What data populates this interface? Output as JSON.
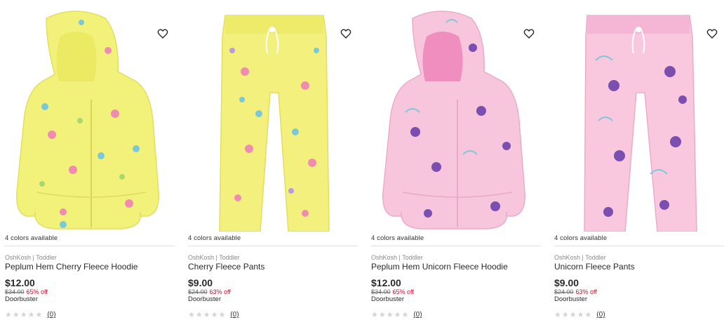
{
  "products": [
    {
      "colors_available": "4 colors available",
      "brand": "OshKosh | Toddler",
      "title": "Peplum Hem Cherry Fleece Hoodie",
      "price": "$12.00",
      "original_price": "$34.00",
      "discount": "65% off",
      "badge": "Doorbuster",
      "stars": "★★★★★",
      "review_count": "(0)",
      "garment": "hoodie",
      "fabric_color": "#f2f27a",
      "icon": "heart-icon"
    },
    {
      "colors_available": "4 colors available",
      "brand": "OshKosh | Toddler",
      "title": "Cherry Fleece Pants",
      "price": "$9.00",
      "original_price": "$24.00",
      "discount": "63% off",
      "badge": "Doorbuster",
      "stars": "★★★★★",
      "review_count": "(0)",
      "garment": "pants",
      "fabric_color": "#f4f07e",
      "icon": "heart-icon"
    },
    {
      "colors_available": "4 colors available",
      "brand": "OshKosh | Toddler",
      "title": "Peplum Hem Unicorn Fleece Hoodie",
      "price": "$12.00",
      "original_price": "$34.00",
      "discount": "65% off",
      "badge": "Doorbuster",
      "stars": "★★★★★",
      "review_count": "(0)",
      "garment": "hoodie",
      "fabric_color": "#f7c6dd",
      "icon": "heart-icon"
    },
    {
      "colors_available": "4 colors available",
      "brand": "OshKosh | Toddler",
      "title": "Unicorn Fleece Pants",
      "price": "$9.00",
      "original_price": "$24.00",
      "discount": "63% off",
      "badge": "Doorbuster",
      "stars": "★★★★★",
      "review_count": "(0)",
      "garment": "pants",
      "fabric_color": "#f9c8df",
      "icon": "heart-icon"
    }
  ]
}
